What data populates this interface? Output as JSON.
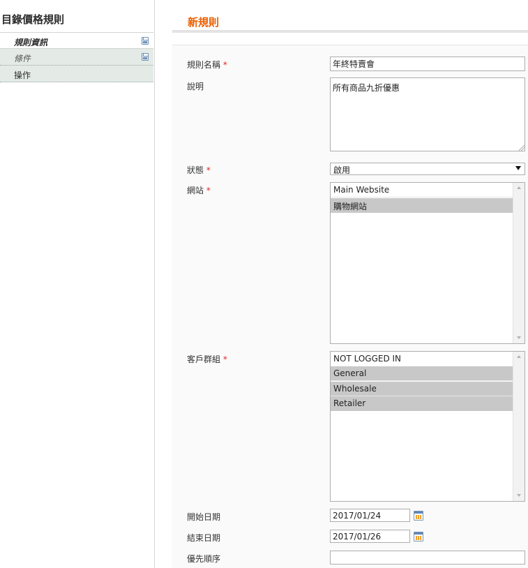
{
  "sidebar": {
    "title": "目錄價格規則",
    "tabs": [
      {
        "label": "規則資訊",
        "icon": "save-icon"
      },
      {
        "label": "條件",
        "icon": "save-icon"
      },
      {
        "label": "操作"
      }
    ]
  },
  "main": {
    "title": "新規則",
    "form": {
      "rule_name": {
        "label": "規則名稱",
        "required_mark": "*",
        "value": "年終特賣會"
      },
      "description": {
        "label": "說明",
        "value": "所有商品九折優惠"
      },
      "status": {
        "label": "狀態",
        "required_mark": "*",
        "selected": "啟用"
      },
      "websites": {
        "label": "網站",
        "required_mark": "*",
        "options": [
          {
            "label": "Main Website",
            "selected": false
          },
          {
            "label": "購物網站",
            "selected": true
          }
        ]
      },
      "customer_groups": {
        "label": "客戶群組",
        "required_mark": "*",
        "options": [
          {
            "label": "NOT LOGGED IN",
            "selected": false
          },
          {
            "label": "General",
            "selected": true
          },
          {
            "label": "Wholesale",
            "selected": true
          },
          {
            "label": "Retailer",
            "selected": true
          }
        ]
      },
      "from_date": {
        "label": "開始日期",
        "value": "2017/01/24"
      },
      "to_date": {
        "label": "結束日期",
        "value": "2017/01/26"
      },
      "priority": {
        "label": "優先順序",
        "value": ""
      }
    }
  },
  "colors": {
    "accent": "#eb5e00",
    "required": "#e22626",
    "tab_background": "#e4ebe6",
    "selected_option": "#c8c8c8"
  }
}
